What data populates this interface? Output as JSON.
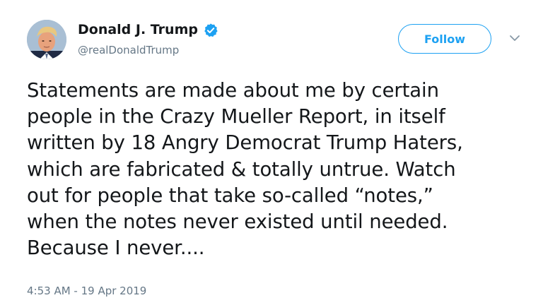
{
  "author": {
    "display_name": "Donald J. Trump",
    "handle": "@realDonaldTrump",
    "verified": true,
    "avatar_icon": "profile-photo"
  },
  "actions": {
    "follow_label": "Follow",
    "more_icon": "chevron-down-icon"
  },
  "tweet": {
    "lines": [
      "Statements are made about me by certain",
      "people in the Crazy Mueller Report, in itself",
      "written by 18 Angry Democrat Trump Haters,",
      "which are fabricated & totally untrue. Watch",
      "out for people that take so-called “notes,”",
      "when the notes never existed until needed.",
      "Because I never...."
    ],
    "timestamp": "4:53 AM - 19 Apr 2019"
  },
  "colors": {
    "accent": "#1da1f2",
    "text": "#14171a",
    "muted": "#657786"
  }
}
